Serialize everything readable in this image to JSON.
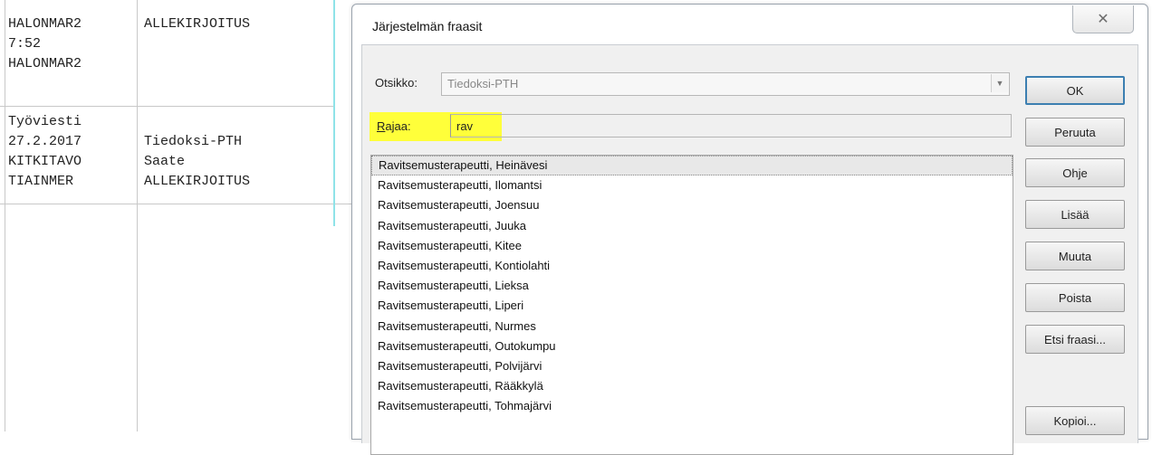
{
  "background_table": {
    "rows": [
      {
        "col1": [
          "HALONMAR2",
          "7:52",
          "HALONMAR2"
        ],
        "col2": [
          "ALLEKIRJOITUS",
          "",
          ""
        ]
      },
      {
        "col1": [
          "Työviesti",
          "27.2.2017",
          "KITKITAVO",
          "TIAINMER"
        ],
        "col2": [
          "",
          "Tiedoksi-PTH",
          "Saate",
          "ALLEKIRJOITUS"
        ]
      }
    ]
  },
  "dialog": {
    "title": "Järjestelmän fraasit",
    "close_glyph": "✕",
    "otsikko_label": "Otsikko:",
    "otsikko_value": "Tiedoksi-PTH",
    "rajaa_label_first": "R",
    "rajaa_label_rest": "ajaa:",
    "rajaa_value": "rav",
    "highlight_color": "#ffff3a",
    "list_items": [
      "Ravitsemusterapeutti, Heinävesi",
      "Ravitsemusterapeutti, Ilomantsi",
      "Ravitsemusterapeutti, Joensuu",
      "Ravitsemusterapeutti, Juuka",
      "Ravitsemusterapeutti, Kitee",
      "Ravitsemusterapeutti, Kontiolahti",
      "Ravitsemusterapeutti, Lieksa",
      "Ravitsemusterapeutti, Liperi",
      "Ravitsemusterapeutti, Nurmes",
      "Ravitsemusterapeutti, Outokumpu",
      "Ravitsemusterapeutti, Polvijärvi",
      "Ravitsemusterapeutti, Rääkkylä",
      "Ravitsemusterapeutti, Tohmajärvi"
    ],
    "buttons": {
      "ok": "OK",
      "peruuta": "Peruuta",
      "ohje": "Ohje",
      "lisaa": "Lisää",
      "muuta": "Muuta",
      "poista": "Poista",
      "etsi": "Etsi fraasi...",
      "kopioi": "Kopioi..."
    }
  }
}
